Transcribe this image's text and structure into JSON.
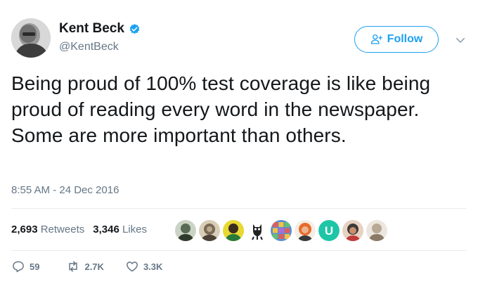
{
  "author": {
    "name": "Kent Beck",
    "handle": "@KentBeck",
    "verified": true,
    "avatar_icon": "profile-photo"
  },
  "follow_button": {
    "label": "Follow",
    "icon": "add-user-icon",
    "color": "#1da1f2"
  },
  "tweet": {
    "text": "Being proud of 100% test coverage is like being proud of reading every word in the newspaper. Some are more important than others.",
    "timestamp": "8:55 AM - 24 Dec 2016"
  },
  "stats": {
    "retweets_count": "2,693",
    "retweets_label": "Retweets",
    "likes_count": "3,346",
    "likes_label": "Likes"
  },
  "likers": [
    {
      "icon": "liker-avatar-1",
      "color": "#5a6b55"
    },
    {
      "icon": "liker-avatar-2",
      "color": "#7a6a55"
    },
    {
      "icon": "liker-avatar-3",
      "color": "#e8d832"
    },
    {
      "icon": "liker-avatar-4",
      "color": "#222222"
    },
    {
      "icon": "liker-avatar-5",
      "color": "#5c8fd0"
    },
    {
      "icon": "liker-avatar-6",
      "color": "#e86a2a"
    },
    {
      "icon": "liker-avatar-7",
      "color": "#1ec5a6",
      "letter": "U"
    },
    {
      "icon": "liker-avatar-8",
      "color": "#3a3a3a"
    },
    {
      "icon": "liker-avatar-9",
      "color": "#b8a995"
    }
  ],
  "actions": {
    "reply_count": "59",
    "retweet_count": "2.7K",
    "like_count": "3.3K"
  },
  "colors": {
    "accent": "#1da1f2",
    "text": "#14171a",
    "muted": "#657786",
    "divider": "#e6ecf0"
  }
}
